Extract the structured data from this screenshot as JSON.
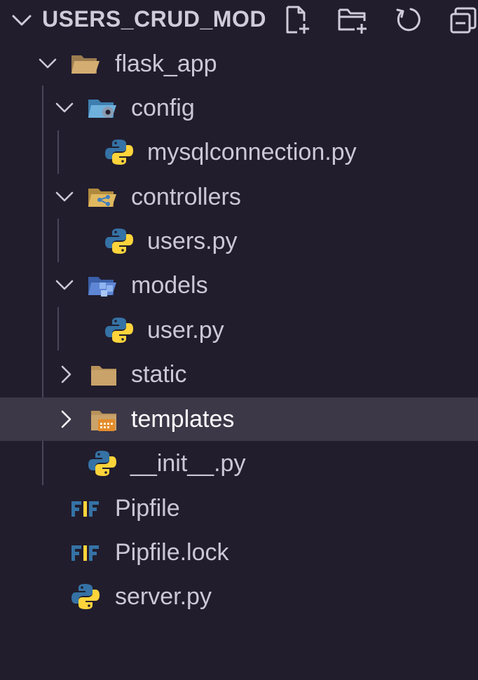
{
  "explorer": {
    "title": "USERS_CRUD_MOD",
    "actions": [
      {
        "name": "new-file-icon"
      },
      {
        "name": "new-folder-icon"
      },
      {
        "name": "refresh-icon"
      },
      {
        "name": "collapse-all-icon"
      }
    ]
  },
  "tree": {
    "flask_app": "flask_app",
    "config": "config",
    "mysqlconnection": "mysqlconnection.py",
    "controllers": "controllers",
    "users_py": "users.py",
    "models": "models",
    "user_py": "user.py",
    "static": "static",
    "templates": "templates",
    "init_py": "__init__.py",
    "pipfile": "Pipfile",
    "pipfile_lock": "Pipfile.lock",
    "server_py": "server.py"
  },
  "selected": "templates",
  "colors": {
    "background": "#211d2d",
    "selection": "#3d3848",
    "folder": "#c9a36a",
    "python_blue": "#3572a5",
    "python_yellow": "#ffd43b"
  }
}
